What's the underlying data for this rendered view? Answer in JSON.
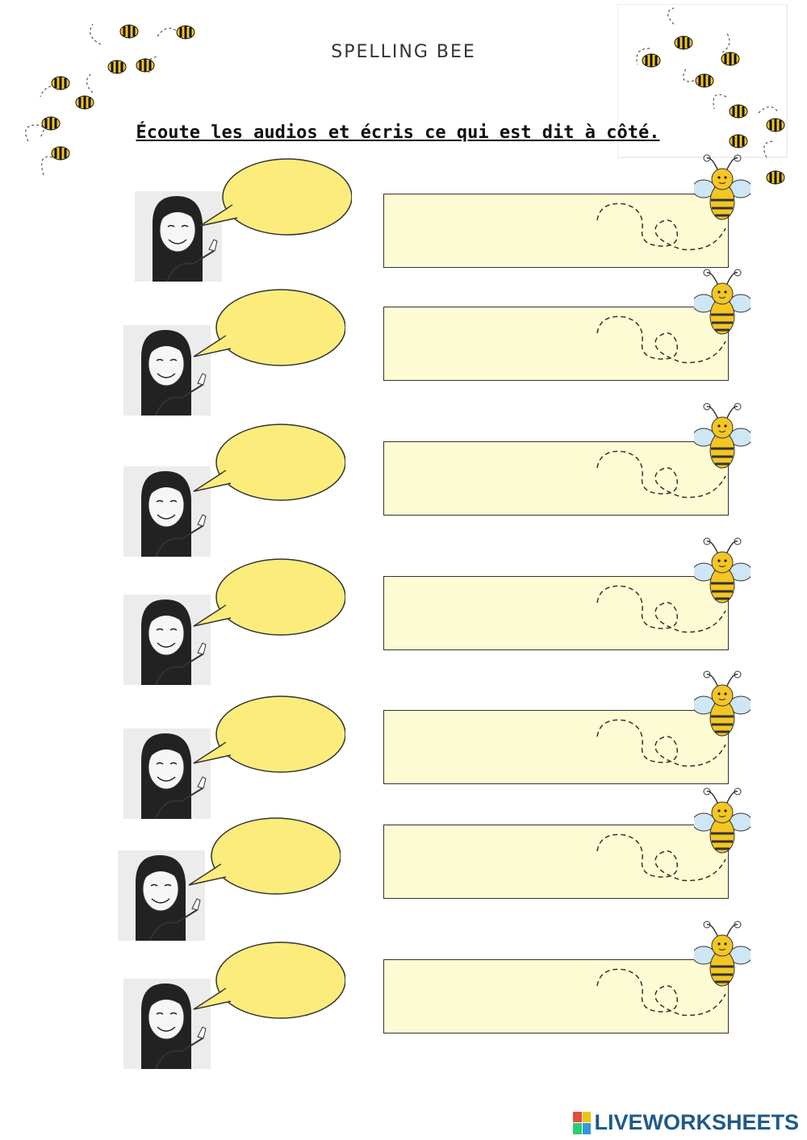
{
  "header": {
    "title": "SPELLING BEE",
    "instruction": "Écoute les audios et écris ce qui est dit à côté."
  },
  "exercise": {
    "items": [
      {
        "answer": ""
      },
      {
        "answer": ""
      },
      {
        "answer": ""
      },
      {
        "answer": ""
      },
      {
        "answer": ""
      },
      {
        "answer": ""
      },
      {
        "answer": ""
      }
    ]
  },
  "colors": {
    "bubble_fill": "#fbec7c",
    "answer_box_fill": "#fdfbd3",
    "bee_yellow": "#f3c623",
    "bee_wing": "#cfe6f5",
    "brand_blue": "#1f5a8a"
  },
  "footer": {
    "brand": "LIVEWORKSHEETS"
  }
}
